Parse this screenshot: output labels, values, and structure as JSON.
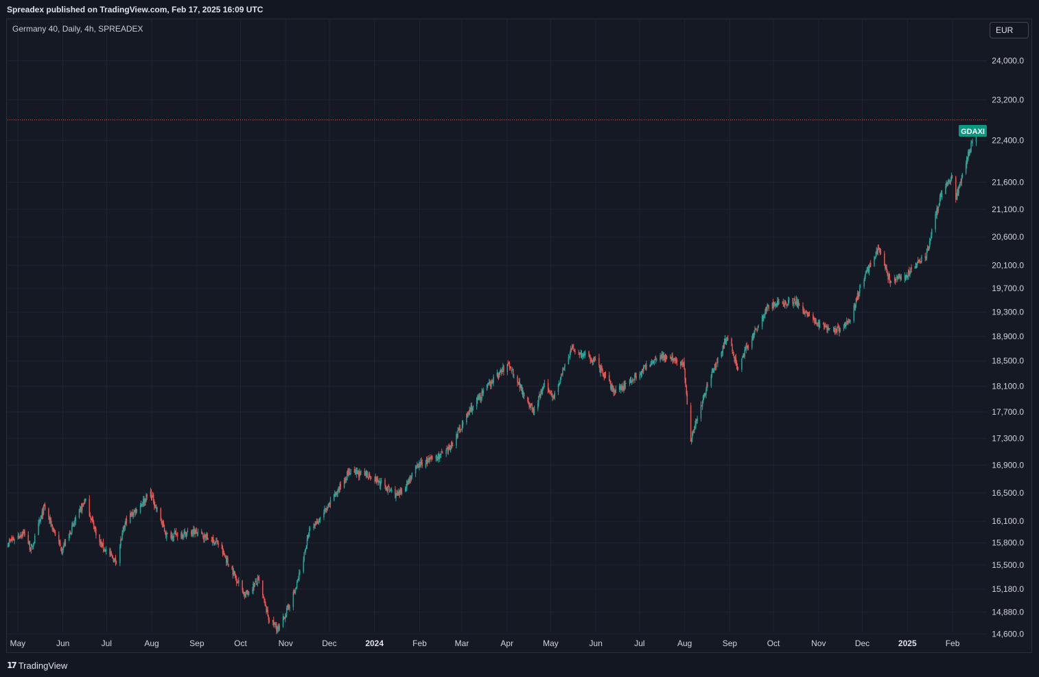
{
  "header": {
    "published": "Spreadex published on TradingView.com, Feb 17, 2025 16:09 UTC"
  },
  "legend": {
    "symbol_line": "Germany 40, Daily, 4h, SPREADEX"
  },
  "currency_button": {
    "label": "EUR"
  },
  "price_tag": {
    "label": "GDAXI",
    "color": "#089981"
  },
  "footer": {
    "brand": "TradingView",
    "logo_mark": "17"
  },
  "colors": {
    "up": "#26a69a",
    "down": "#ef5350",
    "background": "#151924",
    "grid": "#1f2433",
    "price_line": "#ef5350"
  },
  "chart_data": {
    "type": "candlestick",
    "title": "Germany 40, Daily, 4h, SPREADEX",
    "y_axis_labels": [
      "24,000.0",
      "23,200.0",
      "22,400.0",
      "21,600.0",
      "21,100.0",
      "20,600.0",
      "20,100.0",
      "19,700.0",
      "19,300.0",
      "18,900.0",
      "18,500.0",
      "18,100.0",
      "17,700.0",
      "17,300.0",
      "16,900.0",
      "16,500.0",
      "16,100.0",
      "15,800.0",
      "15,500.0",
      "15,180.0",
      "14,880.0",
      "14,600.0"
    ],
    "x_axis_labels": [
      {
        "label": "May",
        "bold": false
      },
      {
        "label": "Jun",
        "bold": false
      },
      {
        "label": "Jul",
        "bold": false
      },
      {
        "label": "Aug",
        "bold": false
      },
      {
        "label": "Sep",
        "bold": false
      },
      {
        "label": "Oct",
        "bold": false
      },
      {
        "label": "Nov",
        "bold": false
      },
      {
        "label": "Dec",
        "bold": false
      },
      {
        "label": "2024",
        "bold": true
      },
      {
        "label": "Feb",
        "bold": false
      },
      {
        "label": "Mar",
        "bold": false
      },
      {
        "label": "Apr",
        "bold": false
      },
      {
        "label": "May",
        "bold": false
      },
      {
        "label": "Jun",
        "bold": false
      },
      {
        "label": "Jul",
        "bold": false
      },
      {
        "label": "Aug",
        "bold": false
      },
      {
        "label": "Sep",
        "bold": false
      },
      {
        "label": "Oct",
        "bold": false
      },
      {
        "label": "Nov",
        "bold": false
      },
      {
        "label": "Dec",
        "bold": false
      },
      {
        "label": "2025",
        "bold": true
      },
      {
        "label": "Feb",
        "bold": false
      }
    ],
    "y_range": [
      14560,
      24600
    ],
    "log_scale": true,
    "grid": true,
    "current_price_line": 22800,
    "price_path": [
      [
        "2023-04-24",
        15800
      ],
      [
        "2023-05-05",
        15950
      ],
      [
        "2023-05-10",
        15700
      ],
      [
        "2023-05-19",
        16300
      ],
      [
        "2023-05-31",
        15700
      ],
      [
        "2023-06-16",
        16400
      ],
      [
        "2023-06-26",
        15800
      ],
      [
        "2023-07-07",
        15550
      ],
      [
        "2023-07-14",
        16100
      ],
      [
        "2023-07-31",
        16500
      ],
      [
        "2023-08-11",
        15900
      ],
      [
        "2023-08-31",
        15950
      ],
      [
        "2023-09-15",
        15800
      ],
      [
        "2023-10-04",
        15100
      ],
      [
        "2023-10-13",
        15300
      ],
      [
        "2023-10-20",
        14800
      ],
      [
        "2023-10-27",
        14650
      ],
      [
        "2023-11-08",
        15200
      ],
      [
        "2023-11-17",
        15950
      ],
      [
        "2023-11-30",
        16300
      ],
      [
        "2023-12-14",
        16800
      ],
      [
        "2023-12-29",
        16750
      ],
      [
        "2024-01-17",
        16450
      ],
      [
        "2024-01-31",
        16900
      ],
      [
        "2024-02-20",
        17100
      ],
      [
        "2024-03-07",
        17750
      ],
      [
        "2024-03-22",
        18200
      ],
      [
        "2024-04-02",
        18450
      ],
      [
        "2024-04-19",
        17700
      ],
      [
        "2024-04-26",
        18100
      ],
      [
        "2024-05-03",
        17950
      ],
      [
        "2024-05-15",
        18700
      ],
      [
        "2024-05-31",
        18500
      ],
      [
        "2024-06-14",
        18000
      ],
      [
        "2024-06-28",
        18250
      ],
      [
        "2024-07-15",
        18600
      ],
      [
        "2024-07-31",
        18450
      ],
      [
        "2024-08-05",
        17300
      ],
      [
        "2024-08-16",
        18100
      ],
      [
        "2024-08-30",
        18900
      ],
      [
        "2024-09-06",
        18400
      ],
      [
        "2024-09-27",
        19400
      ],
      [
        "2024-10-15",
        19500
      ],
      [
        "2024-10-31",
        19100
      ],
      [
        "2024-11-14",
        19000
      ],
      [
        "2024-11-21",
        19100
      ],
      [
        "2024-12-02",
        19900
      ],
      [
        "2024-12-12",
        20400
      ],
      [
        "2024-12-20",
        19800
      ],
      [
        "2024-12-30",
        19900
      ],
      [
        "2025-01-14",
        20300
      ],
      [
        "2025-01-24",
        21400
      ],
      [
        "2025-01-31",
        21700
      ],
      [
        "2025-02-03",
        21300
      ],
      [
        "2025-02-10",
        22000
      ],
      [
        "2025-02-17",
        22600
      ]
    ]
  }
}
